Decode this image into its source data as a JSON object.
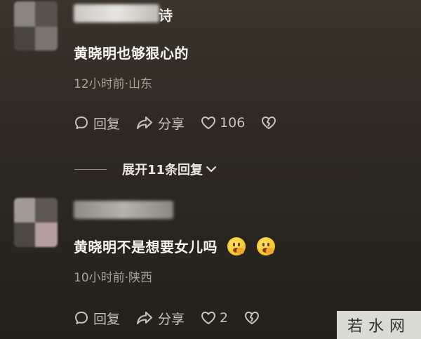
{
  "comments": [
    {
      "username_visible": "诗",
      "text": "黄晓明也够狠心的",
      "meta": "12小时前·山东",
      "reply_label": "回复",
      "share_label": "分享",
      "like_count": "106"
    },
    {
      "username_visible": "",
      "text": "黄晓明不是想要女儿吗",
      "meta": "10小时前·陕西",
      "reply_label": "回复",
      "share_label": "分享",
      "like_count": "2"
    }
  ],
  "expand_replies": {
    "label": "展开11条回复"
  },
  "watermark": {
    "text": "若水网"
  },
  "colors": {
    "background": "#2f2a23",
    "text_primary": "#f6f4ef",
    "text_meta": "#a7a196",
    "action_color": "#c8c3b9"
  },
  "icons": [
    "comment-bubble-icon",
    "share-arrow-icon",
    "heart-icon",
    "broken-heart-icon",
    "chevron-down-icon",
    "thinking-emoji-icon"
  ]
}
